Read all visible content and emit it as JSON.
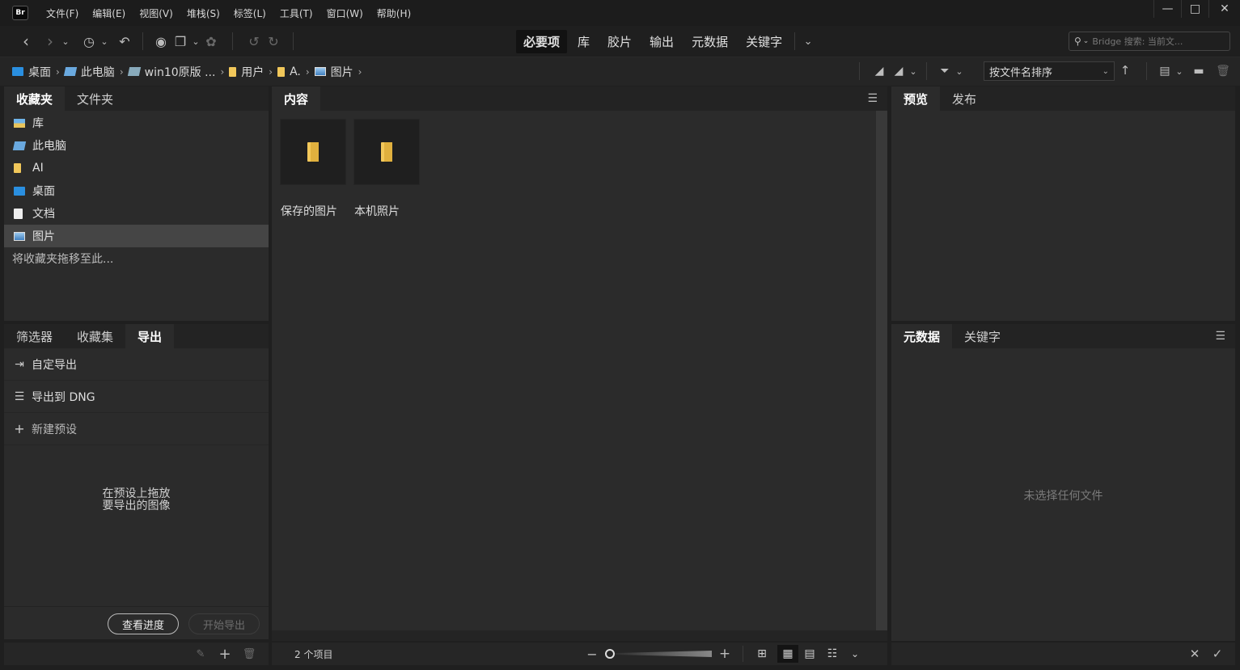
{
  "app": {
    "logo": "Br"
  },
  "menu": [
    "文件(F)",
    "编辑(E)",
    "视图(V)",
    "堆栈(S)",
    "标签(L)",
    "工具(T)",
    "窗口(W)",
    "帮助(H)"
  ],
  "window_controls": {
    "minimize": "—",
    "maximize": "□",
    "close": "✕"
  },
  "workspaces": [
    "必要项",
    "库",
    "胶片",
    "输出",
    "元数据",
    "关键字"
  ],
  "active_workspace": "必要项",
  "search": {
    "placeholder": "Bridge 搜索: 当前文..."
  },
  "path": [
    "桌面",
    "此电脑",
    "win10原版 ...",
    "用户",
    "A.",
    "图片"
  ],
  "sort": {
    "label": "按文件名排序"
  },
  "favorites_panel": {
    "tabs": [
      "收藏夹",
      "文件夹"
    ],
    "items": [
      {
        "label": "库",
        "icon": "library-icon"
      },
      {
        "label": "此电脑",
        "icon": "computer-icon"
      },
      {
        "label": "AI",
        "icon": "folder-icon"
      },
      {
        "label": "桌面",
        "icon": "desktop-icon"
      },
      {
        "label": "文档",
        "icon": "document-icon"
      },
      {
        "label": "图片",
        "icon": "pictures-icon",
        "selected": true
      }
    ],
    "hint": "将收藏夹拖移至此..."
  },
  "export_panel": {
    "tabs": [
      "筛选器",
      "收藏集",
      "导出"
    ],
    "rows": [
      {
        "label": "自定导出",
        "icon": "export-icon"
      },
      {
        "label": "导出到 DNG",
        "icon": "list-icon"
      },
      {
        "label": "新建预设",
        "icon": "plus-icon"
      }
    ],
    "drop_hint_line1": "在预设上拖放",
    "drop_hint_line2": "要导出的图像",
    "view_progress": "查看进度",
    "start_export": "开始导出"
  },
  "content_panel": {
    "tab": "内容",
    "items": [
      {
        "name": "保存的图片"
      },
      {
        "name": "本机照片"
      }
    ],
    "status": "2 个项目"
  },
  "preview_panel": {
    "tabs": [
      "预览",
      "发布"
    ]
  },
  "metadata_panel": {
    "tabs": [
      "元数据",
      "关键字"
    ],
    "empty": "未选择任何文件"
  }
}
